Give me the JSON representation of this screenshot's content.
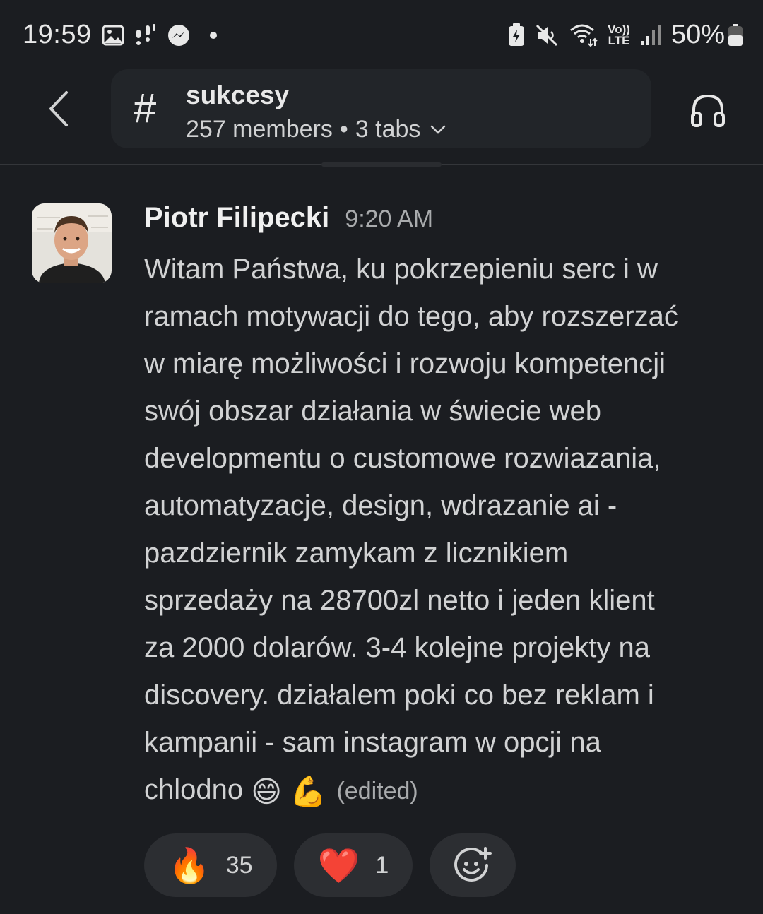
{
  "status_bar": {
    "time": "19:59",
    "battery_percent": "50%",
    "left_icons": [
      "gallery-icon",
      "notification-dots-icon",
      "messenger-icon",
      "dot-icon"
    ],
    "right_icons": [
      "battery-saver-icon",
      "mute-icon",
      "wifi-icon",
      "volte-icon",
      "signal-icon",
      "battery-icon"
    ],
    "volte_label_top": "Vo))",
    "volte_label_bottom": "LTE"
  },
  "header": {
    "channel_hash": "#",
    "channel_name": "sukcesy",
    "members": "257 members",
    "meta_dot": "•",
    "tabs": "3 tabs"
  },
  "message": {
    "author": "Piotr Filipecki",
    "timestamp": "9:20 AM",
    "text": "Witam Państwa, ku pokrzepieniu serc i w\nramach motywacji do tego, aby rozszerzać\nw miarę możliwości i rozwoju kompetencji\nswój obszar działania w świecie web\ndevelopmentu o customowe rozwiazania,\nautomatyzacje, design, wdrazanie ai -\npazdziernik zamykam z licznikiem\nsprzedaży na 28700zl netto i jeden klient\nza 2000 dolarów. 3-4 kolejne projekty na\ndiscovery. działalem poki co bez reklam i\nkampanii - sam instagram w opcji na\nchlodno",
    "emoji_1": "😄",
    "emoji_2": "💪",
    "edited_label": "(edited)"
  },
  "reactions": [
    {
      "emoji": "🔥",
      "count": "35"
    },
    {
      "emoji": "❤️",
      "count": "1"
    }
  ],
  "colors": {
    "background": "#1b1d21",
    "pill": "#222529",
    "reaction_bg": "#2c2e32",
    "text": "#d1d2d3",
    "muted": "#a9abad"
  }
}
